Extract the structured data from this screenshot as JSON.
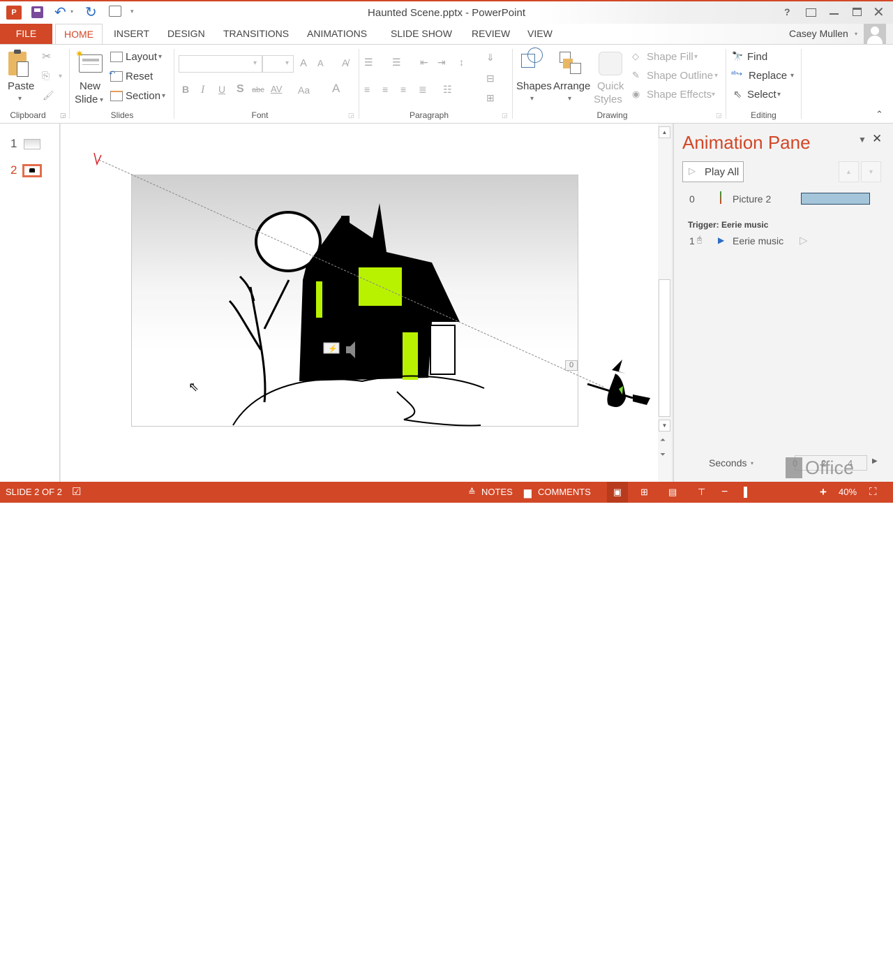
{
  "title": {
    "text": "Haunted Scene.pptx - PowerPoint",
    "app_icon": "powerpoint-icon",
    "quick_access": [
      "save-icon",
      "undo-icon",
      "redo-icon",
      "start-from-beginning-icon",
      "customize-qat-icon"
    ]
  },
  "window_controls": {
    "help": "?",
    "ribbon_display": "ribbon-display-icon",
    "minimize": "minimize-icon",
    "maximize": "maximize-icon",
    "close": "close-icon"
  },
  "user": {
    "name": "Casey Mullen"
  },
  "tabs": [
    {
      "label": "FILE"
    },
    {
      "label": "HOME"
    },
    {
      "label": "INSERT"
    },
    {
      "label": "DESIGN"
    },
    {
      "label": "TRANSITIONS"
    },
    {
      "label": "ANIMATIONS"
    },
    {
      "label": "SLIDE SHOW"
    },
    {
      "label": "REVIEW"
    },
    {
      "label": "VIEW"
    }
  ],
  "ribbon": {
    "clipboard": {
      "label": "Clipboard",
      "paste": "Paste"
    },
    "slides": {
      "label": "Slides",
      "new_slide_1": "New",
      "new_slide_2": "Slide",
      "layout": "Layout",
      "reset": "Reset",
      "section": "Section"
    },
    "font": {
      "label": "Font",
      "font_name": "",
      "font_size": "",
      "bold": "B",
      "italic": "I",
      "underline": "U",
      "shadow": "S",
      "strike": "abc",
      "spacing": "AV",
      "case": "Aa",
      "color": "A",
      "grow": "A",
      "shrink": "A"
    },
    "paragraph": {
      "label": "Paragraph"
    },
    "drawing": {
      "label": "Drawing",
      "shapes": "Shapes",
      "arrange": "Arrange",
      "quick_styles_1": "Quick",
      "quick_styles_2": "Styles",
      "shape_fill": "Shape Fill",
      "shape_outline": "Shape Outline",
      "shape_effects": "Shape Effects"
    },
    "editing": {
      "label": "Editing",
      "find": "Find",
      "replace": "Replace",
      "select": "Select"
    }
  },
  "thumbnails": [
    {
      "number": "1",
      "selected": false
    },
    {
      "number": "2",
      "selected": true
    }
  ],
  "slide": {
    "motion_path_label": "0"
  },
  "animation_pane": {
    "title": "Animation Pane",
    "play_all": "Play All",
    "items": [
      {
        "index": "0",
        "name": "Picture 2",
        "effect": "motion-path"
      }
    ],
    "trigger_label": "Trigger: Eerie music",
    "trigger_items": [
      {
        "index": "1",
        "name": "Eerie music",
        "effect": "play-media"
      }
    ],
    "timeline_unit": "Seconds",
    "timeline_ticks": [
      "0",
      "2",
      "4"
    ],
    "watermark": "Office"
  },
  "status": {
    "slide": "SLIDE 2 OF 2",
    "notes": "NOTES",
    "comments": "COMMENTS",
    "zoom": "40%",
    "zoom_level": 0.4
  },
  "colors": {
    "accent": "#d24726",
    "timing_bar": "#a5c5da",
    "lime": "#b9f200"
  }
}
